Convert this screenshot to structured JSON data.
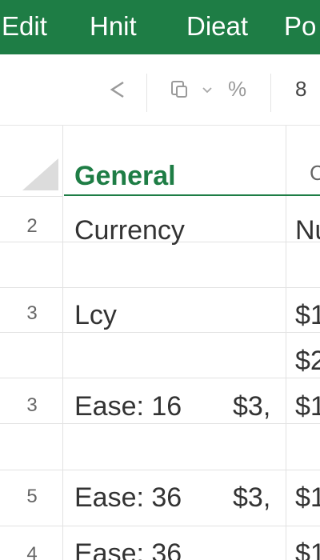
{
  "menu": {
    "items": [
      "Edit",
      "Hnit",
      "Dieat",
      "Po"
    ]
  },
  "toolbar": {
    "percent_label": "%",
    "font_size": "8"
  },
  "columns": {
    "b_header": "General",
    "c_header": "C"
  },
  "rows": [
    {
      "num": "2",
      "b": "Currency",
      "b2": "",
      "c": "Nu"
    },
    {
      "num": "3",
      "b": "Lcy",
      "b2": "",
      "c": "$1"
    },
    {
      "num": "",
      "b": "",
      "b2": "",
      "c": "$2"
    },
    {
      "num": "3",
      "b": "Ease: 16",
      "b2": "$3,",
      "c": "$1"
    },
    {
      "num": "5",
      "b": "Ease: 36",
      "b2": "$3,",
      "c": "$1"
    },
    {
      "num": "4",
      "b": "Ease: 36",
      "b2": "",
      "c": "$1"
    }
  ],
  "colors": {
    "accent": "#1e7d45",
    "grid_line": "#e2e2e2"
  }
}
